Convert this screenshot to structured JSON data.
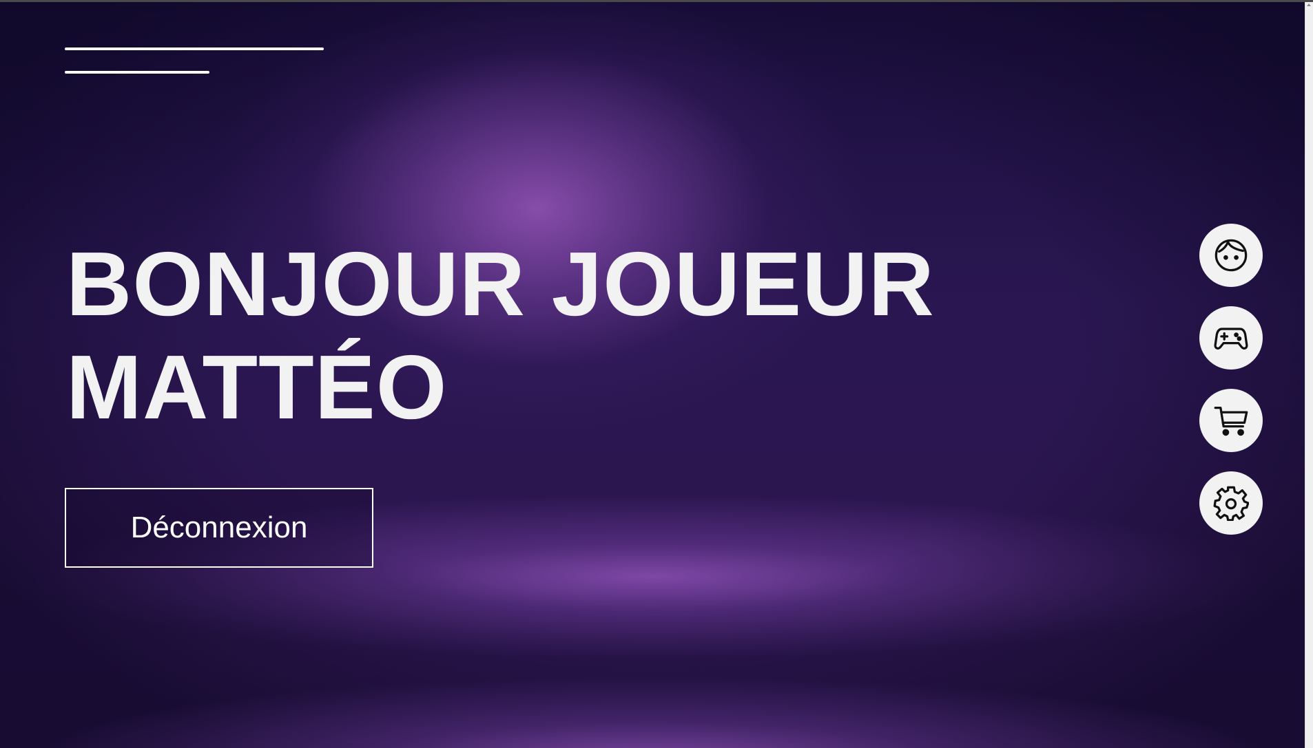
{
  "greeting": {
    "line1": "BONJOUR JOUEUR",
    "line2": "MATTÉO"
  },
  "logout": {
    "label": "Déconnexion"
  },
  "side_nav": {
    "items": [
      {
        "icon": "face-icon"
      },
      {
        "icon": "gamepad-icon"
      },
      {
        "icon": "cart-icon"
      },
      {
        "icon": "gear-icon"
      }
    ]
  },
  "colors": {
    "background_dark": "#1a0e3c",
    "background_glow": "#8c50af",
    "text": "#f2f2f2",
    "nav_button_bg": "#f2f2f2"
  }
}
